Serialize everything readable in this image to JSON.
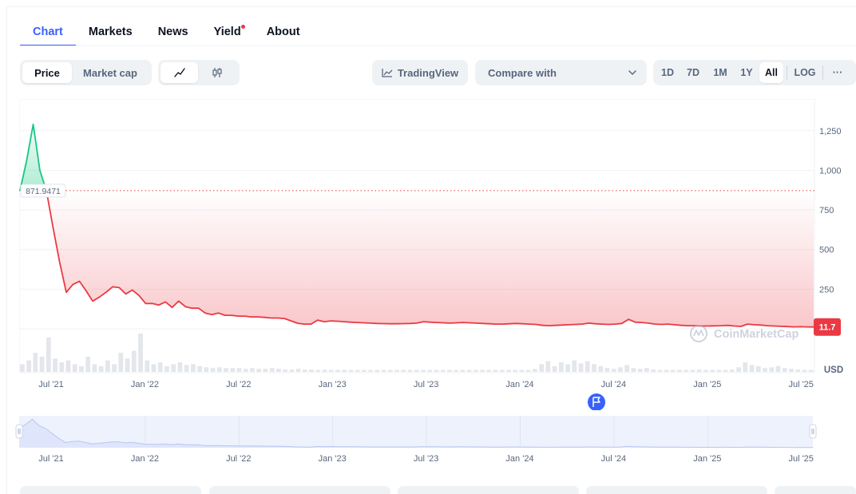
{
  "tabs": [
    {
      "label": "Chart"
    },
    {
      "label": "Markets"
    },
    {
      "label": "News"
    },
    {
      "label": "Yield"
    },
    {
      "label": "About"
    }
  ],
  "toolbar": {
    "price_label": "Price",
    "market_cap_label": "Market cap",
    "tradingview_label": "TradingView",
    "compare_label": "Compare with",
    "ranges": [
      "1D",
      "7D",
      "1M",
      "1Y",
      "All"
    ],
    "log_label": "LOG",
    "more_label": "···"
  },
  "colors": {
    "accent": "#3861fb",
    "down": "#ea3943",
    "up": "#16c784"
  },
  "watermark": "CoinMarketCap",
  "chart_data": {
    "type": "line",
    "currency_label": "USD",
    "y_ticks": [
      250,
      500,
      750,
      1000,
      1250
    ],
    "y_tick_labels": [
      "250",
      "500",
      "750",
      "1,000",
      "1,250"
    ],
    "ylim": [
      -20,
      1410
    ],
    "x_ticks": [
      "Jul '21",
      "Jan '22",
      "Jul '22",
      "Jan '23",
      "Jul '23",
      "Jan '24",
      "Jul '24",
      "Jan '25",
      "Jul '25"
    ],
    "reference_value_label": "871.9471",
    "reference_value": 871.9471,
    "current_value_label": "11.7",
    "current_value": 11.7,
    "series": [
      {
        "values": [
          871.9,
          1060,
          1290,
          1000,
          871.9,
          640,
          420,
          230,
          280,
          300,
          240,
          175,
          200,
          230,
          265,
          260,
          220,
          245,
          210,
          160,
          160,
          150,
          170,
          135,
          175,
          140,
          130,
          130,
          100,
          90,
          100,
          85,
          85,
          80,
          80,
          75,
          75,
          72,
          68,
          68,
          65,
          50,
          35,
          30,
          30,
          55,
          45,
          50,
          48,
          45,
          42,
          40,
          38,
          36,
          34,
          33,
          32,
          32,
          33,
          34,
          36,
          45,
          42,
          40,
          38,
          36,
          38,
          40,
          38,
          36,
          34,
          32,
          30,
          30,
          32,
          34,
          32,
          30,
          28,
          22,
          20,
          22,
          24,
          26,
          28,
          30,
          36,
          32,
          30,
          28,
          30,
          34,
          60,
          42,
          40,
          36,
          30,
          28,
          30,
          26,
          22,
          20,
          20,
          18,
          18,
          19,
          20,
          22,
          18,
          15,
          30,
          26,
          24,
          20,
          18,
          16,
          14,
          12,
          13,
          12,
          11.7
        ]
      }
    ],
    "volume": [
      0.2,
      0.3,
      0.5,
      0.4,
      0.9,
      0.35,
      0.25,
      0.3,
      0.2,
      0.15,
      0.4,
      0.2,
      0.15,
      0.3,
      0.2,
      0.5,
      0.35,
      0.55,
      1.0,
      0.3,
      0.2,
      0.25,
      0.15,
      0.2,
      0.25,
      0.18,
      0.2,
      0.15,
      0.12,
      0.1,
      0.12,
      0.1,
      0.1,
      0.1,
      0.08,
      0.1,
      0.08,
      0.08,
      0.1,
      0.08,
      0.06,
      0.06,
      0.08,
      0.06,
      0.06,
      0.05,
      0.06,
      0.05,
      0.05,
      0.05,
      0.05,
      0.05,
      0.05,
      0.05,
      0.05,
      0.05,
      0.05,
      0.05,
      0.05,
      0.05,
      0.05,
      0.05,
      0.05,
      0.05,
      0.05,
      0.05,
      0.05,
      0.05,
      0.05,
      0.05,
      0.05,
      0.05,
      0.05,
      0.05,
      0.05,
      0.05,
      0.05,
      0.05,
      0.08,
      0.2,
      0.28,
      0.15,
      0.25,
      0.2,
      0.3,
      0.22,
      0.28,
      0.2,
      0.15,
      0.1,
      0.08,
      0.12,
      0.18,
      0.1,
      0.08,
      0.1,
      0.06,
      0.05,
      0.05,
      0.05,
      0.05,
      0.05,
      0.05,
      0.06,
      0.05,
      0.05,
      0.05,
      0.05,
      0.06,
      0.12,
      0.25,
      0.18,
      0.15,
      0.1,
      0.12,
      0.15,
      0.1,
      0.08,
      0.06,
      0.05,
      0.05
    ]
  }
}
